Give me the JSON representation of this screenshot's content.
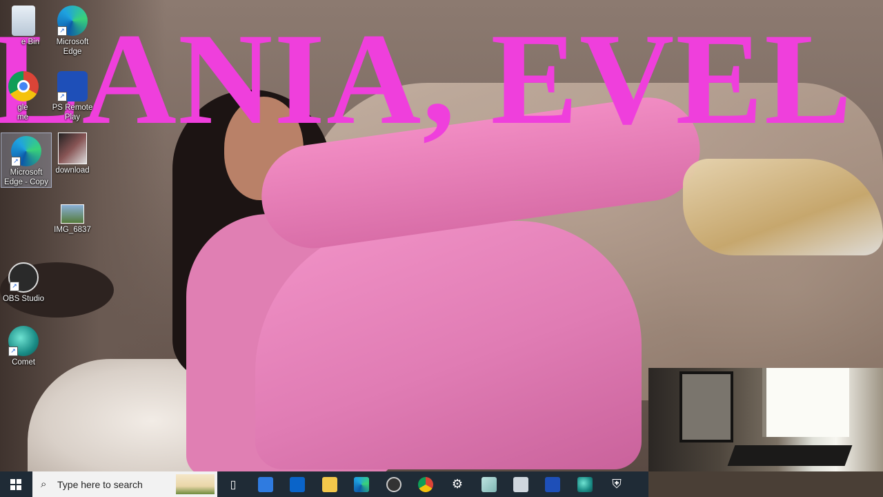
{
  "overlay": {
    "text": "LANIA, EVEL"
  },
  "desktop_icons": [
    {
      "label": "e Bin"
    },
    {
      "label": "Microsoft Edge"
    },
    {
      "label": "gle me"
    },
    {
      "label": "PS Remote Play"
    },
    {
      "label": "Microsoft Edge - Copy"
    },
    {
      "label": "download"
    },
    {
      "label": "IMG_6837"
    },
    {
      "label": "OBS Studio"
    },
    {
      "label": "Comet"
    }
  ],
  "taskbar": {
    "search_placeholder": "Type here to search",
    "search_icon": "⌕",
    "pinned": [
      {
        "name": "task-view-icon",
        "glyph": "▯"
      },
      {
        "name": "store-icon",
        "glyph": "🛍"
      },
      {
        "name": "outlook-icon",
        "glyph": "✉"
      },
      {
        "name": "file-explorer-icon",
        "glyph": "📁"
      },
      {
        "name": "edge-icon",
        "glyph": ""
      },
      {
        "name": "obs-icon",
        "glyph": ""
      },
      {
        "name": "chrome-icon",
        "glyph": ""
      },
      {
        "name": "settings-icon",
        "glyph": "⚙"
      },
      {
        "name": "notepad-icon",
        "glyph": "▦"
      },
      {
        "name": "remote-desktop-icon",
        "glyph": "▭"
      },
      {
        "name": "ps-remote-play-icon",
        "glyph": "◈"
      },
      {
        "name": "comet-icon",
        "glyph": ""
      },
      {
        "name": "security-icon",
        "glyph": "⛨"
      }
    ]
  },
  "colors": {
    "overlay_text": "#ef3fdc",
    "taskbar": "#1f2b36"
  }
}
